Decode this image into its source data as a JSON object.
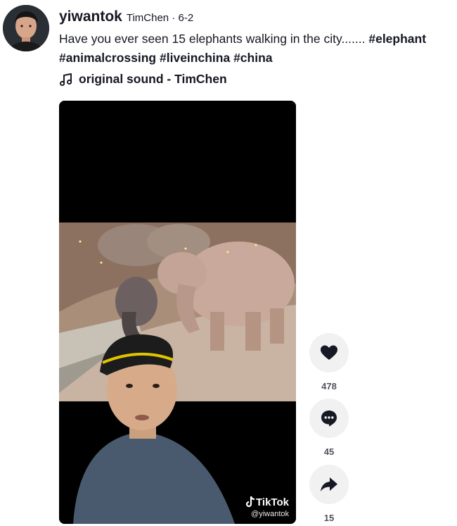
{
  "post": {
    "username": "yiwantok",
    "meta": "TimChen · 6-2",
    "caption_text": "Have you ever seen 15 elephants walking in the city.......",
    "hashtags": [
      "#elephant",
      "#animalcrossing",
      "#liveinchina",
      "#china"
    ],
    "sound_label": "original sound - TimChen"
  },
  "video": {
    "watermark_brand": "TikTok",
    "watermark_handle": "@yiwantok"
  },
  "actions": {
    "likes": "478",
    "comments": "45",
    "shares": "15"
  },
  "icons": {
    "music": "music-note-icon",
    "like": "heart-icon",
    "comment": "comment-bubble-icon",
    "share": "share-arrow-icon",
    "brand": "tiktok-logo-icon"
  }
}
